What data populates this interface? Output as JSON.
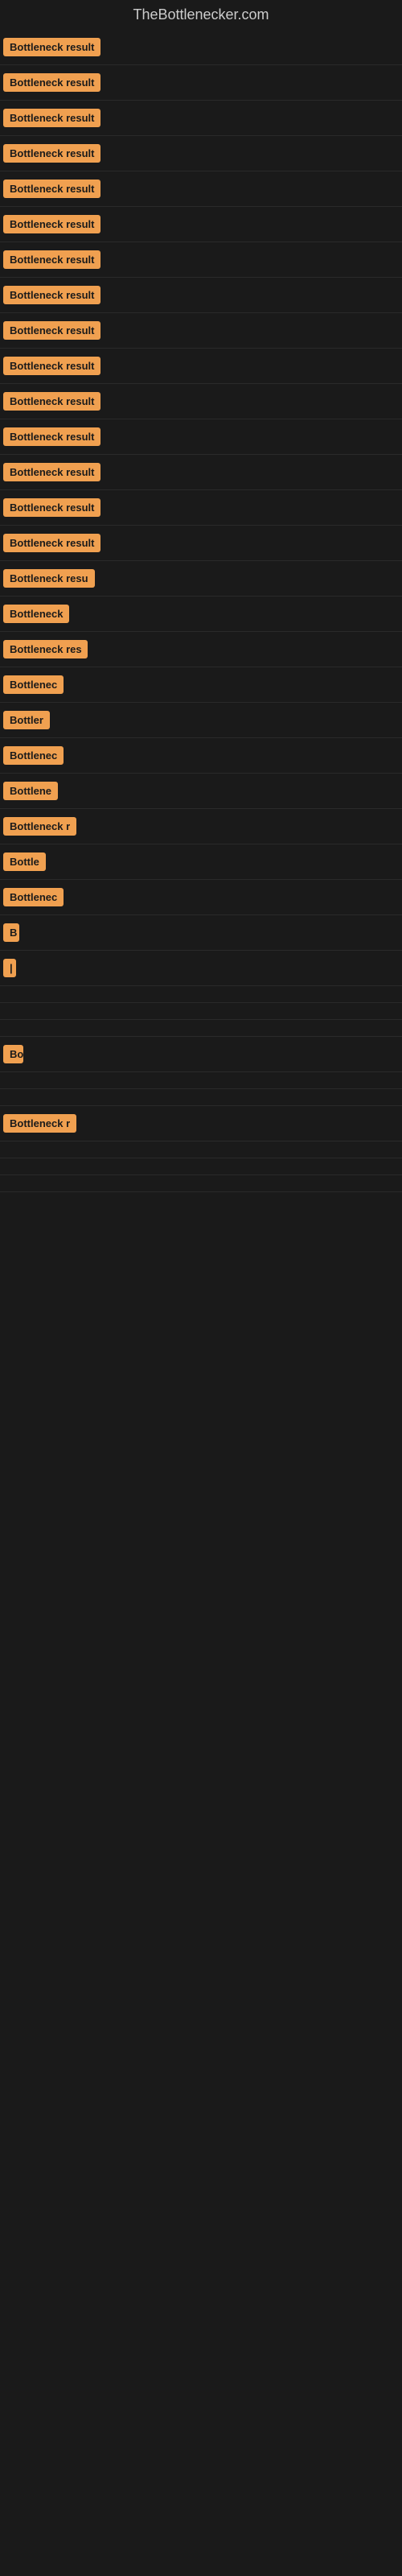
{
  "site": {
    "title": "TheBottlenecker.com"
  },
  "badges": [
    {
      "label": "Bottleneck result",
      "width": 130
    },
    {
      "label": "Bottleneck result",
      "width": 130
    },
    {
      "label": "Bottleneck result",
      "width": 130
    },
    {
      "label": "Bottleneck result",
      "width": 130
    },
    {
      "label": "Bottleneck result",
      "width": 130
    },
    {
      "label": "Bottleneck result",
      "width": 130
    },
    {
      "label": "Bottleneck result",
      "width": 130
    },
    {
      "label": "Bottleneck result",
      "width": 130
    },
    {
      "label": "Bottleneck result",
      "width": 130
    },
    {
      "label": "Bottleneck result",
      "width": 130
    },
    {
      "label": "Bottleneck result",
      "width": 130
    },
    {
      "label": "Bottleneck result",
      "width": 130
    },
    {
      "label": "Bottleneck result",
      "width": 130
    },
    {
      "label": "Bottleneck result",
      "width": 130
    },
    {
      "label": "Bottleneck result",
      "width": 130
    },
    {
      "label": "Bottleneck resu",
      "width": 120
    },
    {
      "label": "Bottleneck",
      "width": 90
    },
    {
      "label": "Bottleneck res",
      "width": 105
    },
    {
      "label": "Bottlenec",
      "width": 85
    },
    {
      "label": "Bottler",
      "width": 65
    },
    {
      "label": "Bottlenec",
      "width": 85
    },
    {
      "label": "Bottlene",
      "width": 78
    },
    {
      "label": "Bottleneck r",
      "width": 95
    },
    {
      "label": "Bottle",
      "width": 58
    },
    {
      "label": "Bottlenec",
      "width": 85
    },
    {
      "label": "B",
      "width": 20
    },
    {
      "label": "|",
      "width": 12
    },
    {
      "label": "",
      "width": 0
    },
    {
      "label": "",
      "width": 0
    },
    {
      "label": "",
      "width": 0
    },
    {
      "label": "Bo",
      "width": 25
    },
    {
      "label": "",
      "width": 0
    },
    {
      "label": "",
      "width": 0
    },
    {
      "label": "Bottleneck r",
      "width": 95
    },
    {
      "label": "",
      "width": 0
    },
    {
      "label": "",
      "width": 0
    },
    {
      "label": "",
      "width": 0
    }
  ]
}
